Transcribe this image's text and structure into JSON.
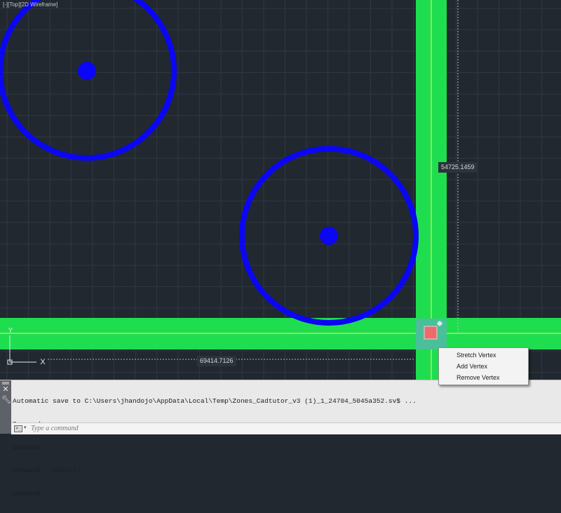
{
  "viewport": {
    "label": "[-][Top][2D Wireframe]",
    "background": "#212830",
    "grid_color": "#2e3742",
    "zone_color": "#1ede4f",
    "circle_color": "#0b06f4",
    "vertex_grip_color": "#ef6a6a"
  },
  "dimensions": {
    "vertical_value": "54725.1459",
    "horizontal_value": "69414.7126"
  },
  "context_menu": {
    "items": [
      {
        "label": "Stretch Vertex"
      },
      {
        "label": "Add Vertex"
      },
      {
        "label": "Remove Vertex"
      }
    ]
  },
  "command_window": {
    "history": [
      "Automatic save to C:\\Users\\jhandojo\\AppData\\Local\\Temp\\Zones_Cadtutor_v3 (1)_1_24704_5045a352.sv$ ...",
      "Command:",
      "Command:",
      "Command: *Cancel*",
      "Command:"
    ],
    "input_placeholder": "Type a command",
    "close_icon": "close-icon",
    "settings_icon": "wrench-icon",
    "prompt_icon": "command-prompt-icon"
  },
  "ucs_icon": {
    "x_axis_label": "X",
    "y_axis_label": "Y"
  }
}
